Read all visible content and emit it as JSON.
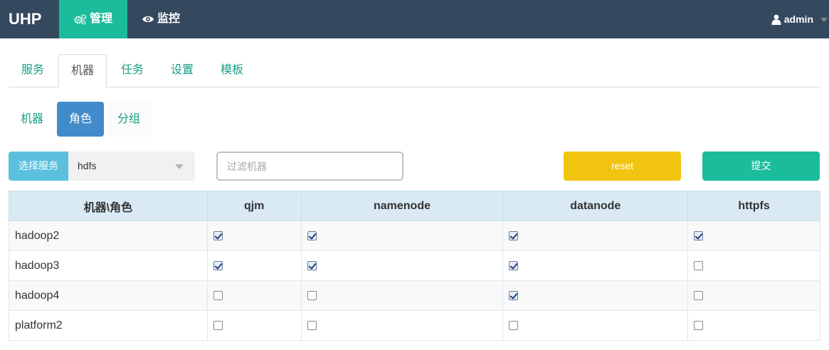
{
  "navbar": {
    "brand": "UHP",
    "items": [
      {
        "label": "管理",
        "icon": "gears-icon"
      },
      {
        "label": "监控",
        "icon": "eye-icon"
      }
    ],
    "user": {
      "name": "admin",
      "icon": "user-icon"
    },
    "colors": {
      "bar": "#34495e",
      "active": "#1abc9c"
    }
  },
  "tabs": [
    "服务",
    "机器",
    "任务",
    "设置",
    "模板"
  ],
  "active_tab": "机器",
  "subtabs": [
    "机器",
    "角色",
    "分组"
  ],
  "active_subtab": "角色",
  "filters": {
    "service_label": "选择服务",
    "service_value": "hdfs",
    "filter_placeholder": "过滤机器",
    "reset_label": "reset",
    "submit_label": "提交"
  },
  "table": {
    "columns": [
      "机器\\角色",
      "qjm",
      "namenode",
      "datanode",
      "httpfs"
    ],
    "rows": [
      {
        "host": "hadoop2",
        "roles": [
          true,
          true,
          true,
          true
        ]
      },
      {
        "host": "hadoop3",
        "roles": [
          true,
          true,
          true,
          false
        ]
      },
      {
        "host": "hadoop4",
        "roles": [
          false,
          false,
          true,
          false
        ]
      },
      {
        "host": "platform2",
        "roles": [
          false,
          false,
          false,
          false
        ]
      }
    ]
  }
}
